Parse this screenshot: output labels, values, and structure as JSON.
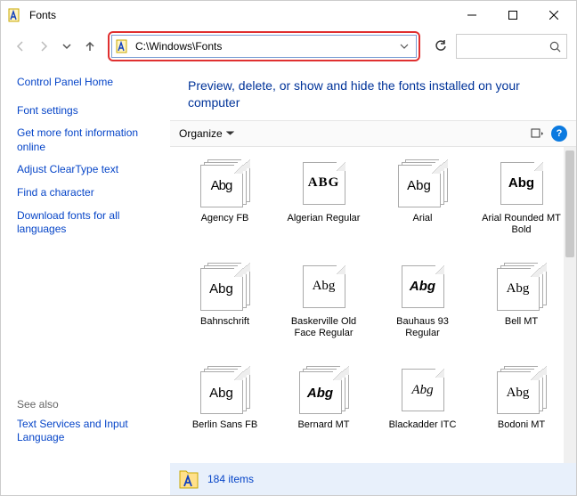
{
  "window": {
    "title": "Fonts"
  },
  "address": {
    "path": "C:\\Windows\\Fonts"
  },
  "sidebar": {
    "home": "Control Panel Home",
    "links": [
      "Font settings",
      "Get more font information online",
      "Adjust ClearType text",
      "Find a character",
      "Download fonts for all languages"
    ],
    "see_also_label": "See also",
    "see_also": [
      "Text Services and Input Language"
    ]
  },
  "main": {
    "heading": "Preview, delete, or show and hide the fonts installed on your computer",
    "organize_label": "Organize"
  },
  "fonts": [
    {
      "label": "Agency FB",
      "sample": "Abg",
      "cls": "st-agency",
      "stack": true
    },
    {
      "label": "Algerian Regular",
      "sample": "ABG",
      "cls": "st-algerian",
      "stack": false
    },
    {
      "label": "Arial",
      "sample": "Abg",
      "cls": "st-arial",
      "stack": true
    },
    {
      "label": "Arial Rounded MT Bold",
      "sample": "Abg",
      "cls": "st-arialround",
      "stack": false
    },
    {
      "label": "Bahnschrift",
      "sample": "Abg",
      "cls": "st-bahn",
      "stack": true
    },
    {
      "label": "Baskerville Old Face Regular",
      "sample": "Abg",
      "cls": "st-bask",
      "stack": false
    },
    {
      "label": "Bauhaus 93 Regular",
      "sample": "Abg",
      "cls": "st-bauhaus",
      "stack": false
    },
    {
      "label": "Bell MT",
      "sample": "Abg",
      "cls": "st-bell",
      "stack": true
    },
    {
      "label": "Berlin Sans FB",
      "sample": "Abg",
      "cls": "st-berlin",
      "stack": true
    },
    {
      "label": "Bernard MT",
      "sample": "Abg",
      "cls": "st-bernard",
      "stack": true
    },
    {
      "label": "Blackadder ITC",
      "sample": "Abg",
      "cls": "st-black",
      "stack": false
    },
    {
      "label": "Bodoni MT",
      "sample": "Abg",
      "cls": "st-bodoni",
      "stack": true
    }
  ],
  "status": {
    "count": "184 items"
  },
  "icons": {
    "app": "font-app-icon",
    "help": "?"
  }
}
